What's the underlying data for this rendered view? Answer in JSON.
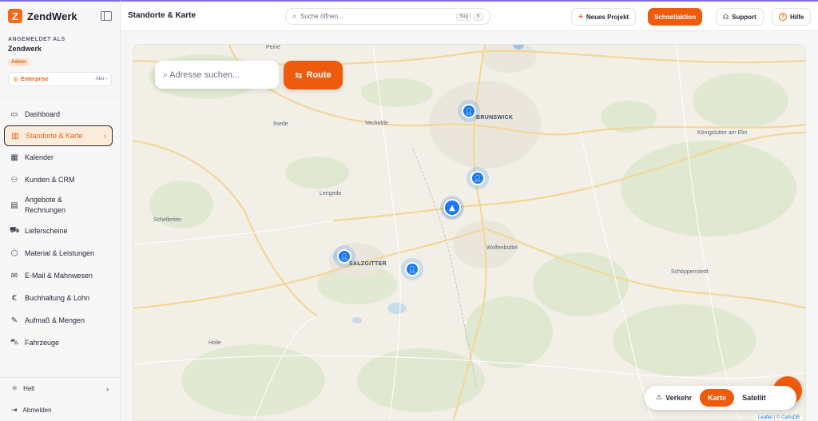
{
  "app": {
    "name": "ZendWerk",
    "logo_letter": "Z"
  },
  "account": {
    "caption": "ANGEMELDET ALS",
    "name": "Zendwerk",
    "role": "Admin",
    "plan": "Enterprise",
    "plan_action": "Abo ›"
  },
  "sidebar": {
    "items": [
      {
        "label": "Dashboard",
        "icon": "monitor-icon"
      },
      {
        "label": "Standorte & Karte",
        "icon": "map-icon",
        "active": true
      },
      {
        "label": "Kalender",
        "icon": "calendar-icon"
      },
      {
        "label": "Kunden & CRM",
        "icon": "users-icon"
      },
      {
        "label": "Angebote & Rechnungen",
        "icon": "document-icon"
      },
      {
        "label": "Lieferscheine",
        "icon": "truck-icon"
      },
      {
        "label": "Material & Leistungen",
        "icon": "box-icon"
      },
      {
        "label": "E-Mail & Mahnwesen",
        "icon": "mail-icon"
      },
      {
        "label": "Buchhaltung & Lohn",
        "icon": "euro-icon"
      },
      {
        "label": "Aufmaß & Mengen",
        "icon": "ruler-icon"
      },
      {
        "label": "Fahrzeuge",
        "icon": "car-icon"
      }
    ],
    "theme_label": "Hell",
    "logout_label": "Abmelden"
  },
  "header": {
    "title": "Standorte & Karte",
    "search_placeholder": "Suche öffnen...",
    "shortcut_1": "Strg",
    "shortcut_2": "K",
    "new_project": "Neues Projekt",
    "quick_actions": "Schnellaktion",
    "support": "Support",
    "help": "Hilfe"
  },
  "map": {
    "address_placeholder": "Adresse suchen...",
    "route_label": "Route",
    "places": [
      {
        "name": "Peine"
      },
      {
        "name": "BRUNSWICK",
        "city": true
      },
      {
        "name": "Königslutter am Elm"
      },
      {
        "name": "Ilsede"
      },
      {
        "name": "Vechelde"
      },
      {
        "name": "Lengede"
      },
      {
        "name": "Schellerten"
      },
      {
        "name": "SALZGITTER",
        "city": true
      },
      {
        "name": "Wolfenbüttel"
      },
      {
        "name": "Schöppenstedt"
      },
      {
        "name": "Holle"
      }
    ],
    "toggle": {
      "traffic": "Verkehr",
      "map": "Karte",
      "satellite": "Satellit",
      "active": "Karte"
    },
    "attribution_leaflet": "Leaflet",
    "attribution_sep": "| ©",
    "attribution_carto": "CartoDB"
  },
  "colors": {
    "accent": "#ef5b0c",
    "marker": "#1a78f2",
    "active_nav_bg": "#fdebdc"
  }
}
